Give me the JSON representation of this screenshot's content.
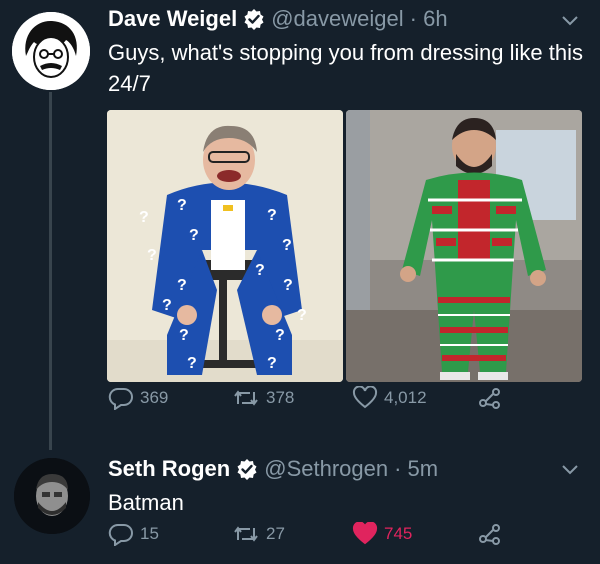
{
  "tweets": [
    {
      "name": "Dave Weigel",
      "handle": "@daveweigel",
      "time": "· 6h",
      "text": "Guys, what's stopping you from dressing like this 24/7",
      "replies": "369",
      "retweets": "378",
      "likes": "4,012",
      "liked": false
    },
    {
      "name": "Seth Rogen",
      "handle": "@Sethrogen",
      "time": "· 5m",
      "text": "Batman",
      "replies": "15",
      "retweets": "27",
      "likes": "745",
      "liked": true
    }
  ],
  "colors": {
    "background": "#15202b",
    "secondary_text": "#8899a6",
    "verified_blue": "#1da1f2",
    "like_red": "#e0245e",
    "thread_line": "#38444d"
  },
  "icons": [
    "reply-icon",
    "retweet-icon",
    "like-icon",
    "share-icon",
    "verified-icon",
    "chevron-down-icon"
  ]
}
